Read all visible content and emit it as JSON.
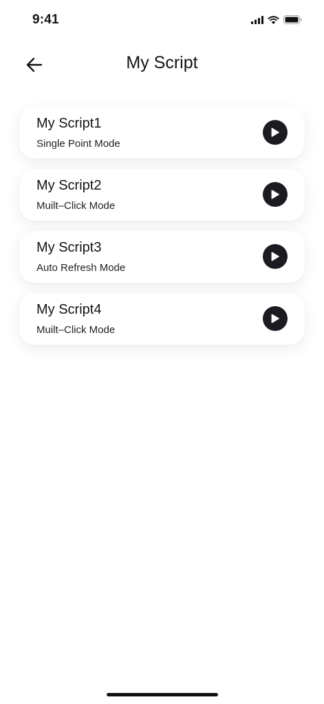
{
  "status_bar": {
    "time": "9:41",
    "icons": [
      "signal-icon",
      "wifi-icon",
      "battery-icon"
    ]
  },
  "header": {
    "back_icon": "arrow-left-icon",
    "title": "My Script"
  },
  "scripts": [
    {
      "name": "My Script1",
      "mode": "Single Point Mode"
    },
    {
      "name": "My Script2",
      "mode": "Muilt–Click Mode"
    },
    {
      "name": "My Script3",
      "mode": "Auto Refresh Mode"
    },
    {
      "name": "My Script4",
      "mode": "Muilt–Click Mode"
    }
  ],
  "play_icon": "play-icon",
  "colors": {
    "text": "#141414",
    "play_button": "#1b1b22",
    "background": "#ffffff"
  }
}
